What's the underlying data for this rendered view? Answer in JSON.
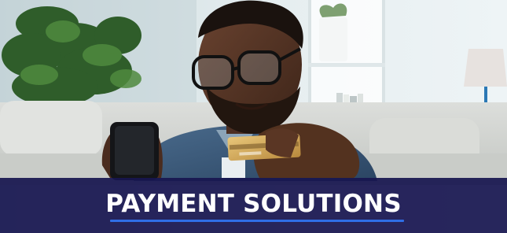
{
  "banner": {
    "title": "PAYMENT SOLUTIONS",
    "background_color": "#181650",
    "text_color": "#ffffff",
    "underline_color": "#2f6ee6"
  },
  "photo": {
    "subject": "man-with-phone-and-credit-card"
  }
}
